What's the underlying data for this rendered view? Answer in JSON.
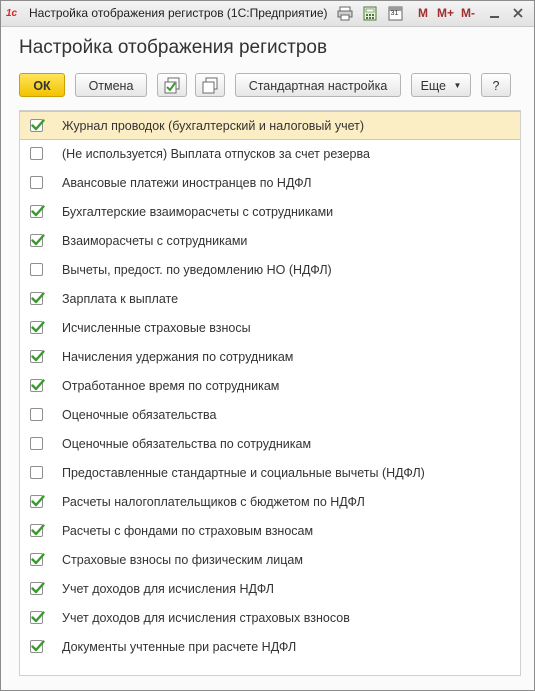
{
  "window": {
    "title": "Настройка отображения регистров  (1С:Предприятие)",
    "logo": "1с",
    "title_icons": [
      "print-icon",
      "calculator-icon",
      "calendar-icon"
    ],
    "calendar_label": "31",
    "memory_buttons": [
      "M",
      "M+",
      "M-"
    ],
    "window_controls": [
      "minimize-icon",
      "close-icon"
    ]
  },
  "form": {
    "heading": "Настройка отображения регистров"
  },
  "toolbar": {
    "ok_label": "ОК",
    "cancel_label": "Отмена",
    "check_all_icon": "check-all-icon",
    "uncheck_all_icon": "uncheck-all-icon",
    "default_label": "Стандартная настройка",
    "more_label": "Еще",
    "help_label": "?"
  },
  "colors": {
    "ok_button": "#f5cb0a",
    "checkmark": "#3a9a2f",
    "selected_row": "#fbeec4"
  },
  "registers": [
    {
      "label": "Журнал проводок (бухгалтерский и налоговый учет)",
      "checked": true,
      "selected": true
    },
    {
      "label": "(Не используется) Выплата отпусков за счет резерва",
      "checked": false
    },
    {
      "label": "Авансовые платежи иностранцев по НДФЛ",
      "checked": false
    },
    {
      "label": "Бухгалтерские взаиморасчеты с сотрудниками",
      "checked": true
    },
    {
      "label": "Взаиморасчеты с сотрудниками",
      "checked": true
    },
    {
      "label": "Вычеты, предост. по уведомлению НО (НДФЛ)",
      "checked": false
    },
    {
      "label": "Зарплата к выплате",
      "checked": true
    },
    {
      "label": "Исчисленные страховые взносы",
      "checked": true
    },
    {
      "label": "Начисления удержания по сотрудникам",
      "checked": true
    },
    {
      "label": "Отработанное время по сотрудникам",
      "checked": true
    },
    {
      "label": "Оценочные обязательства",
      "checked": false
    },
    {
      "label": "Оценочные обязательства по сотрудникам",
      "checked": false
    },
    {
      "label": "Предоставленные стандартные и социальные вычеты (НДФЛ)",
      "checked": false
    },
    {
      "label": "Расчеты налогоплательщиков с бюджетом по НДФЛ",
      "checked": true
    },
    {
      "label": "Расчеты с фондами по страховым взносам",
      "checked": true
    },
    {
      "label": "Страховые взносы по физическим лицам",
      "checked": true
    },
    {
      "label": "Учет доходов для исчисления НДФЛ",
      "checked": true
    },
    {
      "label": "Учет доходов для исчисления страховых взносов",
      "checked": true
    },
    {
      "label": "Документы учтенные при расчете НДФЛ",
      "checked": true
    }
  ]
}
